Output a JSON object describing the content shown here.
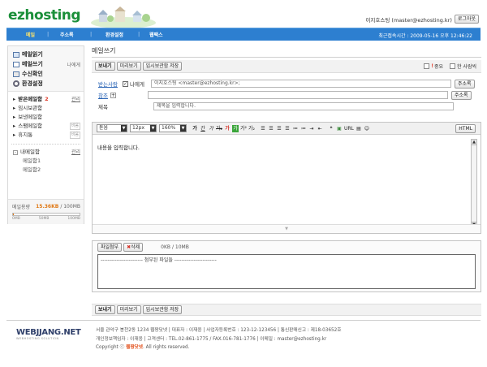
{
  "brand": {
    "logo": "ezhosting"
  },
  "header": {
    "user": "이지호스팅 (master@ezhosting.kr)",
    "logout": "로그아웃",
    "last_login": "최근접속시간 : 2009-05-16 오후 12:46:22"
  },
  "nav": {
    "items": [
      "메일",
      "주소록",
      "환경설정",
      "웹팩스"
    ]
  },
  "sidebar": {
    "top": [
      {
        "label": "메일읽기",
        "extra": ""
      },
      {
        "label": "메일쓰기",
        "extra": "나에게"
      },
      {
        "label": "수신확인",
        "extra": ""
      },
      {
        "label": "환경설정",
        "extra": ""
      }
    ],
    "inbox": {
      "label": "받은메일함",
      "count": "2",
      "manage": "관리"
    },
    "folders": [
      {
        "label": "임시보관함",
        "tag": ""
      },
      {
        "label": "보낸메일함",
        "tag": ""
      },
      {
        "label": "스팸메일함",
        "tag": "비움"
      },
      {
        "label": "휴지통",
        "tag": "비움"
      }
    ],
    "mybox": {
      "label": "내메일함",
      "manage": "관리",
      "items": [
        "메일함1",
        "메일함2"
      ]
    },
    "quota": {
      "label": "메일용량",
      "used": "15.36KB",
      "total": "/ 100MB",
      "ticks": [
        "0MB",
        "50MB",
        "100MB"
      ],
      "fraction": 0.0002
    }
  },
  "compose": {
    "title": "메일쓰기",
    "send": "보내기",
    "preview": "미리보기",
    "draft": "임시보관함 저장",
    "important": "중요",
    "each_person": "한 사람씩",
    "to_label": "받는사람",
    "to_self": "나에게",
    "to_value": "이지호스팅 <master@ezhosting.kr>;",
    "cc_label": "참조",
    "subject_label": "제목",
    "subject_value": "제목을 입력합니다.",
    "addr_book": "주소록",
    "font": "돋움",
    "size": "12px",
    "line": "160%",
    "html": "HTML",
    "toolbar": [
      "가",
      "간",
      "가",
      "가₂",
      "가",
      "가",
      "가²",
      "가₂"
    ],
    "body_text": "내용을 입력합니다.",
    "attach": "파일첨부",
    "delete": "삭제",
    "attach_size": "0KB / 10MB",
    "attach_hint": "------------------------ 첨부된 파일들 ------------------------"
  },
  "footer": {
    "logo": "WEBJJANG.NET",
    "logo_sub": "WEBHOSTING SOLUTION",
    "line1": "서울 관악구 봉천2동 1234   웹짱닷넷   |   대표자 : 이재웅   |   사업자등록번호 : 123-12-123456   |   통신판매신고 : 제18-03652호",
    "line2": "개인정보책임자 : 이재웅   |   고객센터 : TEL.02-861-1775 / FAX.016-781-1776   |   이메일 : master@ezhosting.kr",
    "copy_pre": "Copyright ⓒ ",
    "copy_brand": "웹짱닷넷",
    "copy_post": ". All rights reserved."
  }
}
